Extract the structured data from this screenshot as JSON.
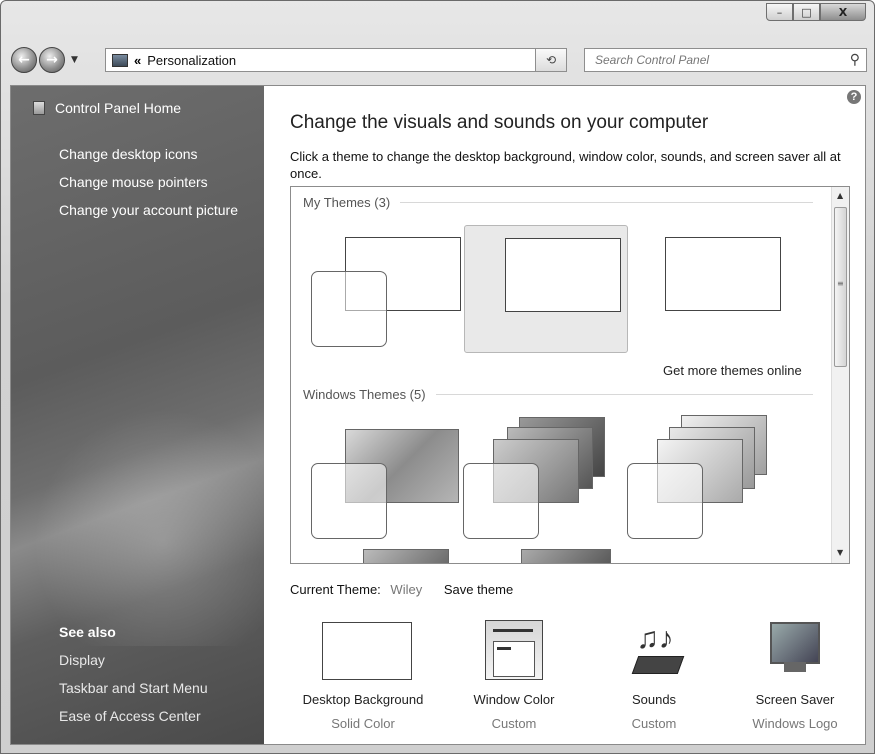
{
  "window": {
    "minimize": "–",
    "maximize": "□",
    "close": "X"
  },
  "nav": {
    "back_icon": "back-arrow-icon",
    "forward_icon": "forward-arrow-icon",
    "breadcrumb_chevron": "«",
    "location": "Personalization",
    "refresh_icon": "⟲"
  },
  "search": {
    "placeholder": "Search Control Panel"
  },
  "sidebar": {
    "home": "Control Panel Home",
    "links": [
      "Change desktop icons",
      "Change mouse pointers",
      "Change your account picture"
    ],
    "see_also": {
      "header": "See also",
      "links": [
        "Display",
        "Taskbar and Start Menu",
        "Ease of Access Center"
      ]
    }
  },
  "main": {
    "help": "?",
    "title": "Change the visuals and sounds on your computer",
    "description": "Click a theme to change the desktop background, window color, sounds, and screen saver all at once.",
    "my_themes_header": "My Themes (3)",
    "get_more": "Get more themes online",
    "windows_themes_header": "Windows Themes (5)",
    "current_theme_label": "Current Theme:",
    "current_theme_value": "Wiley",
    "save_theme": "Save theme"
  },
  "settings": [
    {
      "name": "Desktop Background",
      "value": "Solid Color"
    },
    {
      "name": "Window Color",
      "value": "Custom"
    },
    {
      "name": "Sounds",
      "value": "Custom"
    },
    {
      "name": "Screen Saver",
      "value": "Windows Logo"
    }
  ]
}
